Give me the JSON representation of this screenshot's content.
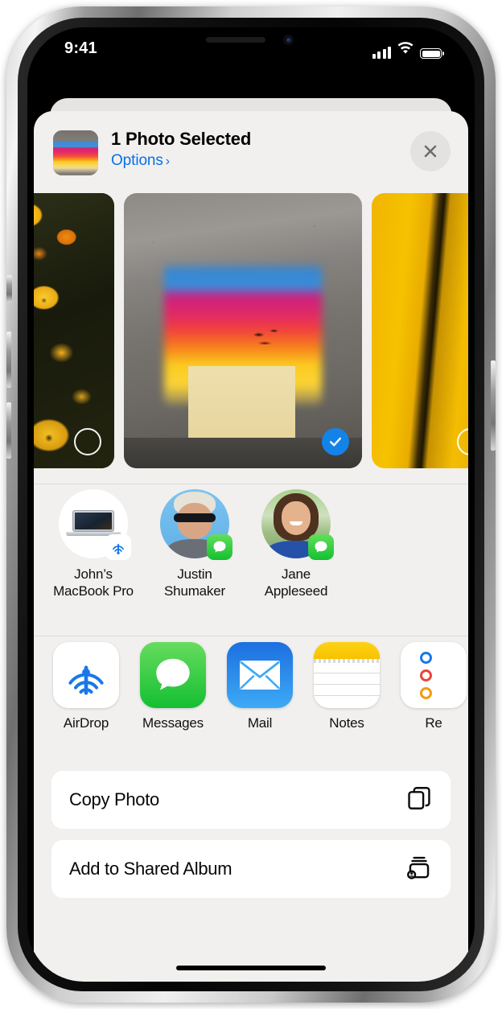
{
  "status_bar": {
    "time": "9:41",
    "cellular_icon": "signal-bars-icon",
    "wifi_icon": "wifi-icon",
    "battery_icon": "battery-full-icon"
  },
  "share_sheet": {
    "header": {
      "title": "1 Photo Selected",
      "options_label": "Options",
      "options_chevron": "›",
      "close_icon": "close-icon",
      "thumbnail_name": "selected-photo-thumbnail"
    },
    "photos": [
      {
        "name": "photo-flowers",
        "selected": false,
        "alt": "yellow and orange flowers"
      },
      {
        "name": "photo-graffiti",
        "selected": true,
        "alt": "rainbow graffiti on concrete wall"
      },
      {
        "name": "photo-yellow",
        "selected": false,
        "alt": "yellow wall with dark stripe"
      }
    ],
    "contacts": [
      {
        "name": "John’s\nMacBook Pro",
        "badge": "airdrop-badge-icon"
      },
      {
        "name": "Justin\nShumaker",
        "badge": "messages-badge-icon"
      },
      {
        "name": "Jane\nAppleseed",
        "badge": "messages-badge-icon"
      }
    ],
    "apps": [
      {
        "label": "AirDrop",
        "icon": "airdrop-icon"
      },
      {
        "label": "Messages",
        "icon": "messages-icon"
      },
      {
        "label": "Mail",
        "icon": "mail-icon"
      },
      {
        "label": "Notes",
        "icon": "notes-icon"
      },
      {
        "label": "Re",
        "icon": "reminders-icon"
      }
    ],
    "actions": [
      {
        "label": "Copy Photo",
        "icon": "copy-icon"
      },
      {
        "label": "Add to Shared Album",
        "icon": "shared-album-icon"
      }
    ]
  },
  "colors": {
    "accent_blue": "#0a6fe8",
    "selection_blue": "#1483e8",
    "messages_green": "#15bf31",
    "mail_blue": "#3eaaf5",
    "notes_yellow": "#fdd216",
    "sheet_background": "#f1f0ee",
    "row_background": "#ffffff"
  }
}
